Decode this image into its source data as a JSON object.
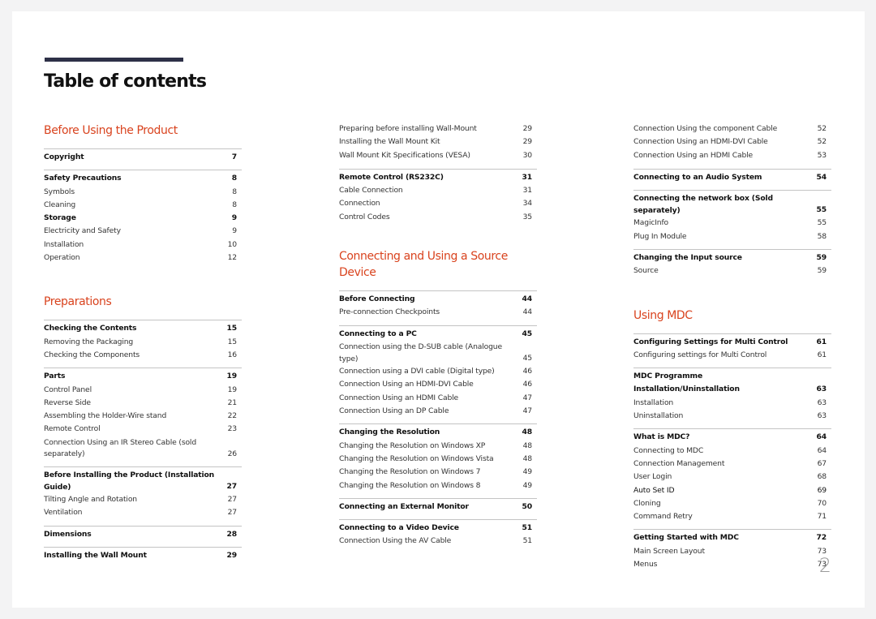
{
  "document": {
    "title": "Table of contents",
    "page_number": "2",
    "colors": {
      "accent": "#d9431e",
      "title_bar": "#2d3047",
      "divider": "#c4c4c4"
    }
  },
  "columns": [
    {
      "blocks": [
        {
          "type": "section",
          "title": "Before Using the Product"
        },
        {
          "type": "group",
          "rows": [
            {
              "label": "Copyright",
              "page": "7",
              "bold": true
            }
          ]
        },
        {
          "type": "group",
          "rows": [
            {
              "label": "Safety Precautions",
              "page": "8",
              "bold": true
            },
            {
              "label": "Symbols",
              "page": "8"
            },
            {
              "label": "Cleaning",
              "page": "8"
            },
            {
              "label": "Storage",
              "page": "9",
              "bold": true
            },
            {
              "label": "Electricity and Safety",
              "page": "9"
            },
            {
              "label": "Installation",
              "page": "10"
            },
            {
              "label": "Operation",
              "page": "12"
            }
          ]
        },
        {
          "type": "section",
          "title": "Preparations"
        },
        {
          "type": "group",
          "rows": [
            {
              "label": "Checking the Contents",
              "page": "15",
              "bold": true
            },
            {
              "label": "Removing the Packaging",
              "page": "15"
            },
            {
              "label": "Checking the Components",
              "page": "16"
            }
          ]
        },
        {
          "type": "group",
          "rows": [
            {
              "label": "Parts",
              "page": "19",
              "bold": true
            },
            {
              "label": "Control Panel",
              "page": "19"
            },
            {
              "label": "Reverse Side",
              "page": "21"
            },
            {
              "label": "Assembling the Holder-Wire stand",
              "page": "22"
            },
            {
              "label": "Remote Control",
              "page": "23"
            },
            {
              "label": "Connection Using an IR Stereo Cable (sold separately)",
              "page": "26",
              "two_line": true
            }
          ]
        },
        {
          "type": "group",
          "rows": [
            {
              "label": "Before Installing the Product (Installation Guide)",
              "page": "27",
              "bold": true,
              "two_line": true
            },
            {
              "label": "Tilting Angle and Rotation",
              "page": "27"
            },
            {
              "label": "Ventilation",
              "page": "27"
            }
          ]
        },
        {
          "type": "group",
          "rows": [
            {
              "label": "Dimensions",
              "page": "28",
              "bold": true
            }
          ]
        },
        {
          "type": "group",
          "rows": [
            {
              "label": "Installing the Wall Mount",
              "page": "29",
              "bold": true
            }
          ]
        }
      ]
    },
    {
      "blocks": [
        {
          "type": "group",
          "no_border": true,
          "rows": [
            {
              "label": "Preparing before installing Wall-Mount",
              "page": "29"
            },
            {
              "label": "Installing the Wall Mount Kit",
              "page": "29"
            },
            {
              "label": "Wall Mount Kit Specifications (VESA)",
              "page": "30"
            }
          ]
        },
        {
          "type": "group",
          "rows": [
            {
              "label": "Remote Control (RS232C)",
              "page": "31",
              "bold": true
            },
            {
              "label": "Cable Connection",
              "page": "31"
            },
            {
              "label": "Connection",
              "page": "34"
            },
            {
              "label": "Control Codes",
              "page": "35"
            }
          ]
        },
        {
          "type": "section",
          "title": "Connecting and Using a Source Device"
        },
        {
          "type": "group",
          "rows": [
            {
              "label": "Before Connecting",
              "page": "44",
              "bold": true
            },
            {
              "label": "Pre-connection Checkpoints",
              "page": "44"
            }
          ]
        },
        {
          "type": "group",
          "rows": [
            {
              "label": "Connecting to a PC",
              "page": "45",
              "bold": true
            },
            {
              "label": "Connection using the D-SUB cable (Analogue type)",
              "page": "45",
              "two_line": true
            },
            {
              "label": "Connection using a DVI cable (Digital type)",
              "page": "46"
            },
            {
              "label": "Connection Using an HDMI-DVI Cable",
              "page": "46"
            },
            {
              "label": "Connection Using an HDMI Cable",
              "page": "47"
            },
            {
              "label": "Connection Using an DP Cable",
              "page": "47"
            }
          ]
        },
        {
          "type": "group",
          "rows": [
            {
              "label": "Changing the Resolution",
              "page": "48",
              "bold": true
            },
            {
              "label": "Changing the Resolution on Windows XP",
              "page": "48"
            },
            {
              "label": "Changing the Resolution on Windows Vista",
              "page": "48"
            },
            {
              "label": "Changing the Resolution on Windows 7",
              "page": "49"
            },
            {
              "label": "Changing the Resolution on Windows 8",
              "page": "49"
            }
          ]
        },
        {
          "type": "group",
          "rows": [
            {
              "label": "Connecting an External Monitor",
              "page": "50",
              "bold": true
            }
          ]
        },
        {
          "type": "group",
          "rows": [
            {
              "label": "Connecting to a Video Device",
              "page": "51",
              "bold": true
            },
            {
              "label": "Connection Using the AV Cable",
              "page": "51"
            }
          ]
        }
      ]
    },
    {
      "blocks": [
        {
          "type": "group",
          "no_border": true,
          "rows": [
            {
              "label": "Connection Using the component Cable",
              "page": "52"
            },
            {
              "label": "Connection Using an HDMI-DVI Cable",
              "page": "52"
            },
            {
              "label": "Connection Using an HDMI Cable",
              "page": "53"
            }
          ]
        },
        {
          "type": "group",
          "rows": [
            {
              "label": "Connecting to an Audio System",
              "page": "54",
              "bold": true
            }
          ]
        },
        {
          "type": "group",
          "rows": [
            {
              "label": "Connecting the network box (Sold separately)",
              "page": "55",
              "bold": true,
              "two_line": true
            },
            {
              "label": "MagicInfo",
              "page": "55"
            },
            {
              "label": "Plug In Module",
              "page": "58"
            }
          ]
        },
        {
          "type": "group",
          "rows": [
            {
              "label": "Changing the Input source",
              "page": "59",
              "bold": true
            },
            {
              "label": "Source",
              "page": "59"
            }
          ]
        },
        {
          "type": "section",
          "title": "Using MDC"
        },
        {
          "type": "group",
          "rows": [
            {
              "label": "Configuring Settings for Multi Control",
              "page": "61",
              "bold": true
            },
            {
              "label": "Configuring settings for Multi Control",
              "page": "61"
            }
          ]
        },
        {
          "type": "group",
          "rows": [
            {
              "label": "MDC Programme Installation/Uninstallation",
              "page": "63",
              "bold": true
            },
            {
              "label": "Installation",
              "page": "63"
            },
            {
              "label": "Uninstallation",
              "page": "63"
            }
          ]
        },
        {
          "type": "group",
          "rows": [
            {
              "label": "What is MDC?",
              "page": "64",
              "bold": true
            },
            {
              "label": "Connecting to MDC",
              "page": "64"
            },
            {
              "label": "Connection Management",
              "page": "67"
            },
            {
              "label": "User Login",
              "page": "68"
            },
            {
              "label": "Auto Set ID",
              "page": "69",
              "semibold": true
            },
            {
              "label": "Cloning",
              "page": "70"
            },
            {
              "label": "Command Retry",
              "page": "71"
            }
          ]
        },
        {
          "type": "group",
          "rows": [
            {
              "label": "Getting Started with MDC",
              "page": "72",
              "bold": true
            },
            {
              "label": "Main Screen Layout",
              "page": "73"
            },
            {
              "label": "Menus",
              "page": "73"
            }
          ]
        }
      ]
    }
  ]
}
